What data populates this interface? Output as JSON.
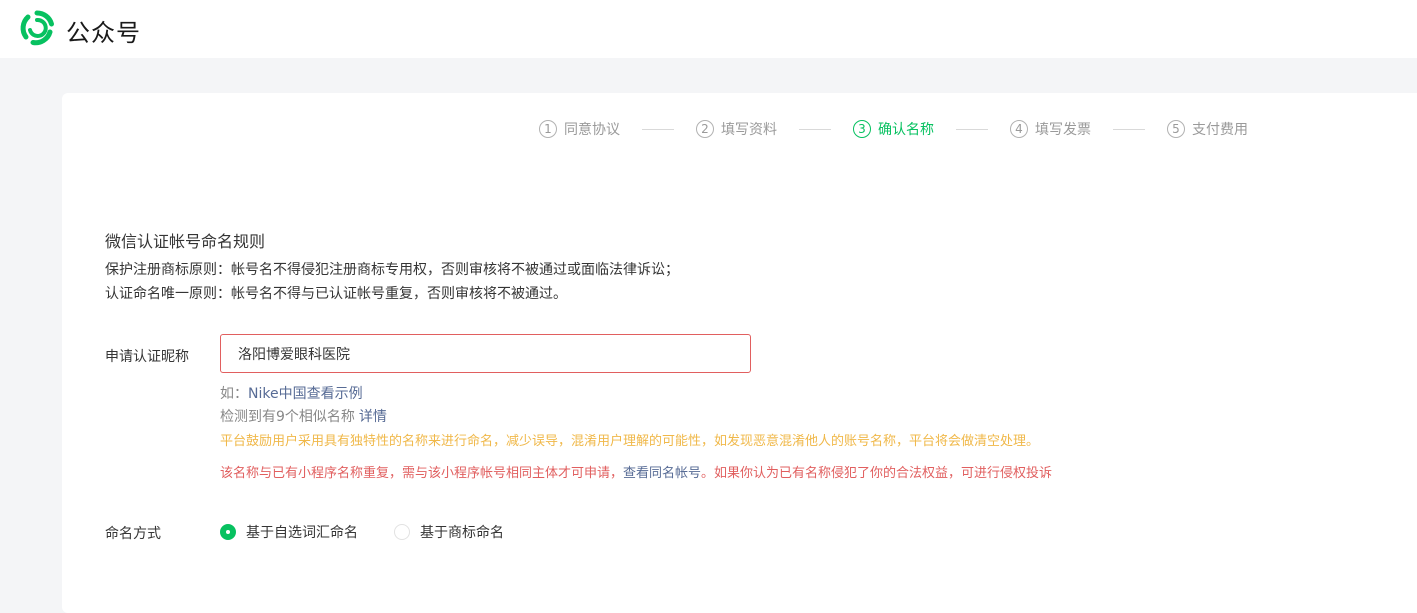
{
  "header": {
    "brand": "公众号",
    "brand_color": "#07c160"
  },
  "steps": [
    {
      "num": "1",
      "label": "同意协议",
      "active": false
    },
    {
      "num": "2",
      "label": "填写资料",
      "active": false
    },
    {
      "num": "3",
      "label": "确认名称",
      "active": true
    },
    {
      "num": "4",
      "label": "填写发票",
      "active": false
    },
    {
      "num": "5",
      "label": "支付费用",
      "active": false
    }
  ],
  "rules": {
    "title": "微信认证帐号命名规则",
    "line1": "保护注册商标原则：帐号名不得侵犯注册商标专用权，否则审核将不被通过或面临法律诉讼；",
    "line2": "认证命名唯一原则：帐号名不得与已认证帐号重复，否则审核将不被通过。"
  },
  "nickname": {
    "label": "申请认证昵称",
    "value": "洛阳博爱眼科医院",
    "example_prefix": "如：",
    "example_link": "Nike中国查看示例",
    "similar_text": "检测到有9个相似名称",
    "similar_link": "详情",
    "warning": "平台鼓励用户采用具有独特性的名称来进行命名，减少误导，混淆用户理解的可能性，如发现恶意混淆他人的账号名称，平台将会做清空处理。",
    "error_part1": "该名称与已有小程序名称重复，需与该小程序帐号相同主体才可申请，",
    "error_link": "查看同名帐号",
    "error_part2": "。如果你认为已有名称侵犯了你的合法权益，可进行",
    "error_link2": "侵权投诉"
  },
  "naming_method": {
    "label": "命名方式",
    "options": [
      {
        "label": "基于自选词汇命名",
        "checked": true
      },
      {
        "label": "基于商标命名",
        "checked": false
      }
    ]
  }
}
